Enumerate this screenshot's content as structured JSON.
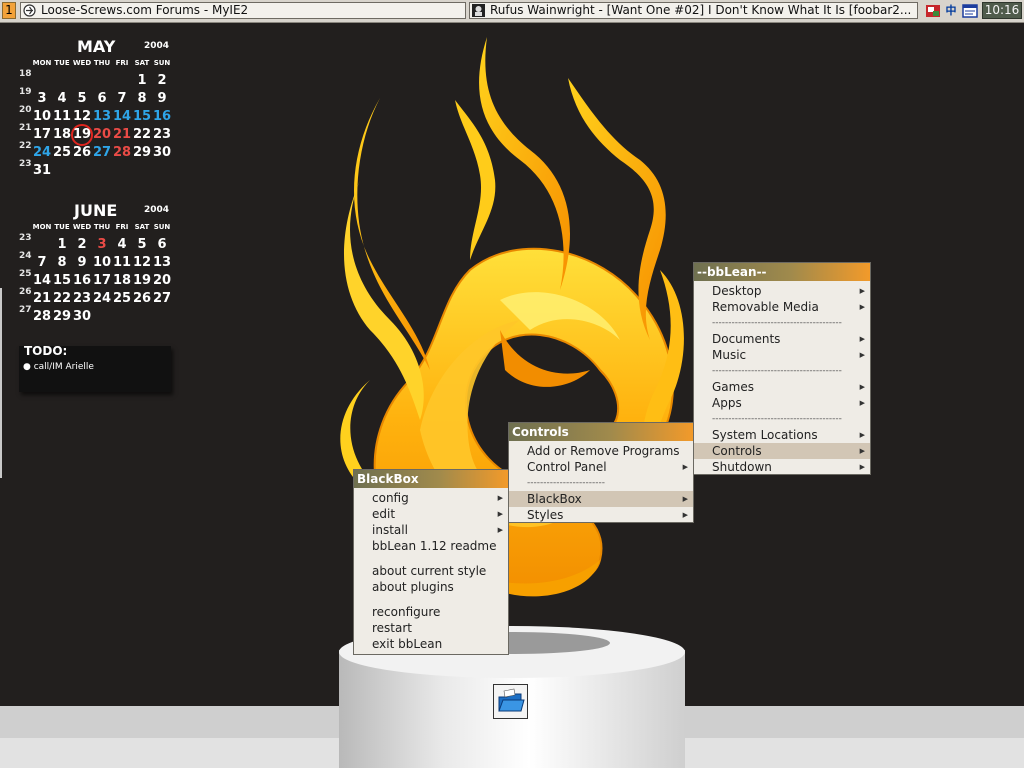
{
  "taskbar": {
    "workspace": "1",
    "tasks": [
      {
        "title": "Loose-Screws.com Forums - MyIE2",
        "icon": "browser-icon"
      },
      {
        "title": "Rufus Wainwright - [Want One #02] I Don't Know What It Is      [foobar2...",
        "icon": "foobar-icon"
      }
    ],
    "tray": [
      {
        "icon": "network-icon"
      },
      {
        "icon": "chinese-ime-icon",
        "text": "中"
      },
      {
        "icon": "window-tray-icon"
      }
    ],
    "clock": "10:16"
  },
  "calendar": {
    "may": {
      "month": "MAY",
      "year": "2004",
      "dow": [
        "MON",
        "TUE",
        "WED",
        "THU",
        "FRI",
        "SAT",
        "SUN"
      ],
      "weeks": [
        {
          "wk": "18",
          "days": [
            "",
            "",
            "",
            "",
            "",
            "1",
            "2"
          ]
        },
        {
          "wk": "19",
          "days": [
            "3",
            "4",
            "5",
            "6",
            "7",
            "8",
            "9"
          ]
        },
        {
          "wk": "20",
          "days": [
            "10",
            "11",
            "12",
            "13",
            "14",
            "15",
            "16"
          ]
        },
        {
          "wk": "21",
          "days": [
            "17",
            "18",
            "19",
            "20",
            "21",
            "22",
            "23"
          ]
        },
        {
          "wk": "22",
          "days": [
            "24",
            "25",
            "26",
            "27",
            "28",
            "29",
            "30"
          ]
        },
        {
          "wk": "23",
          "days": [
            "31",
            "",
            "",
            "",
            "",
            "",
            ""
          ]
        }
      ],
      "today": "19",
      "colors": {
        "13": "blue",
        "14": "blue",
        "15": "blue",
        "16": "blue",
        "20": "red",
        "21": "red",
        "24": "blue",
        "27": "blue",
        "28": "red"
      }
    },
    "june": {
      "month": "JUNE",
      "year": "2004",
      "dow": [
        "MON",
        "TUE",
        "WED",
        "THU",
        "FRI",
        "SAT",
        "SUN"
      ],
      "weeks": [
        {
          "wk": "23",
          "days": [
            "",
            "1",
            "2",
            "3",
            "4",
            "5",
            "6"
          ]
        },
        {
          "wk": "24",
          "days": [
            "7",
            "8",
            "9",
            "10",
            "11",
            "12",
            "13"
          ]
        },
        {
          "wk": "25",
          "days": [
            "14",
            "15",
            "16",
            "17",
            "18",
            "19",
            "20"
          ]
        },
        {
          "wk": "26",
          "days": [
            "21",
            "22",
            "23",
            "24",
            "25",
            "26",
            "27"
          ]
        },
        {
          "wk": "27",
          "days": [
            "28",
            "29",
            "30",
            "",
            "",
            "",
            ""
          ]
        }
      ],
      "colors": {
        "3": "red"
      }
    }
  },
  "todo": {
    "title": "TODO:",
    "items": [
      "call/IM Arielle"
    ]
  },
  "menus": {
    "bblean": {
      "title": "--bbLean--",
      "items": [
        {
          "label": "Desktop",
          "submenu": true
        },
        {
          "label": "Removable Media",
          "submenu": true
        },
        {
          "separator": "----------------------------------------"
        },
        {
          "label": "Documents",
          "submenu": true
        },
        {
          "label": "Music",
          "submenu": true
        },
        {
          "separator": "----------------------------------------"
        },
        {
          "label": "Games",
          "submenu": true
        },
        {
          "label": "Apps",
          "submenu": true
        },
        {
          "separator": "----------------------------------------"
        },
        {
          "label": "System Locations",
          "submenu": true
        },
        {
          "label": "Controls",
          "submenu": true,
          "selected": true
        },
        {
          "label": "Shutdown",
          "submenu": true
        }
      ]
    },
    "controls": {
      "title": "Controls",
      "items": [
        {
          "label": "Add or Remove Programs",
          "submenu": false
        },
        {
          "label": "Control Panel",
          "submenu": true
        },
        {
          "separator": "------------------------"
        },
        {
          "label": "BlackBox",
          "submenu": true,
          "selected": true
        },
        {
          "label": "Styles",
          "submenu": true
        }
      ]
    },
    "blackbox": {
      "title": "BlackBox",
      "items": [
        {
          "label": "config",
          "submenu": true
        },
        {
          "label": "edit",
          "submenu": true
        },
        {
          "label": "install",
          "submenu": true
        },
        {
          "label": "bbLean 1.12 readme",
          "submenu": false
        },
        {
          "gap": true
        },
        {
          "label": "about current style",
          "submenu": false
        },
        {
          "label": "about plugins",
          "submenu": false
        },
        {
          "gap": true
        },
        {
          "label": "reconfigure",
          "submenu": false
        },
        {
          "label": "restart",
          "submenu": false
        },
        {
          "label": "exit bbLean",
          "submenu": false
        }
      ]
    }
  },
  "desktop": {
    "folder_icon": "folder-icon"
  },
  "colors": {
    "accent_orange": "#f29a2a",
    "title_dark": "#6f7050",
    "background": "#221f1e",
    "menu_bg": "#efece6",
    "selection": "#d2c6b5",
    "calendar_blue": "#2fa5e8",
    "calendar_red": "#ea4b46"
  }
}
